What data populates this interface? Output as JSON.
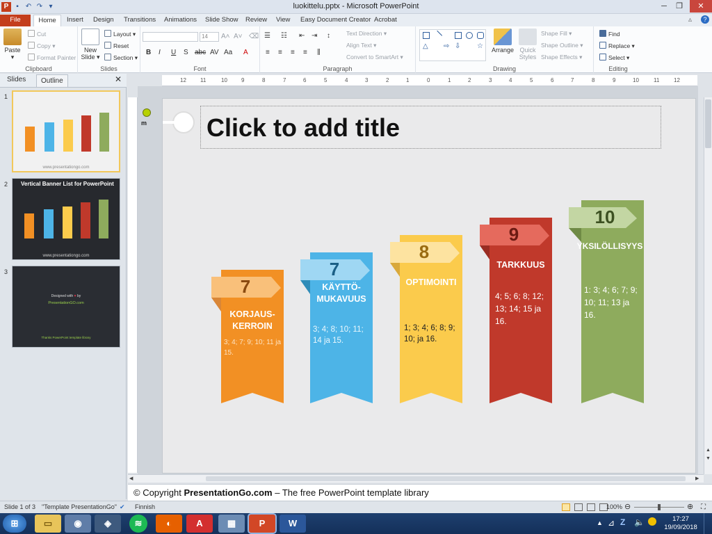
{
  "window": {
    "title": "luokittelu.pptx - Microsoft PowerPoint"
  },
  "tabs": [
    "File",
    "Home",
    "Insert",
    "Design",
    "Transitions",
    "Animations",
    "Slide Show",
    "Review",
    "View",
    "Easy Document Creator",
    "Acrobat"
  ],
  "ribbon": {
    "clipboard": {
      "paste": "Paste",
      "cut": "Cut",
      "copy": "Copy",
      "format_painter": "Format Painter",
      "label": "Clipboard"
    },
    "slides": {
      "new_slide": "New Slide",
      "layout": "Layout",
      "reset": "Reset",
      "section": "Section",
      "label": "Slides"
    },
    "font": {
      "size": "14",
      "label": "Font"
    },
    "paragraph": {
      "text_direction": "Text Direction",
      "align_text": "Align Text",
      "convert_smartart": "Convert to SmartArt",
      "label": "Paragraph"
    },
    "drawing": {
      "arrange": "Arrange",
      "quick_styles": "Quick Styles",
      "shape_fill": "Shape Fill",
      "shape_outline": "Shape Outline",
      "shape_effects": "Shape Effects",
      "label": "Drawing"
    },
    "editing": {
      "find": "Find",
      "replace": "Replace",
      "select": "Select",
      "label": "Editing"
    }
  },
  "panel": {
    "tab_slides": "Slides",
    "tab_outline": "Outline"
  },
  "thumbnails": [
    {
      "num": "1",
      "footer": "www.presentationgo.com"
    },
    {
      "num": "2",
      "title": "Vertical Banner List for PowerPoint",
      "footer": "www.presentationgo.com"
    },
    {
      "num": "3",
      "line1": "Designed with",
      "line2": "by",
      "site": "PresentationGO.com",
      "credit": "Thanks PowerPoint template library"
    }
  ],
  "ruler": [
    "12",
    "11",
    "10",
    "9",
    "8",
    "7",
    "6",
    "5",
    "4",
    "3",
    "2",
    "1",
    "0",
    "1",
    "2",
    "3",
    "4",
    "5",
    "6",
    "7",
    "8",
    "9",
    "10",
    "11",
    "12"
  ],
  "slide": {
    "title_placeholder": "Click to add title",
    "banners": [
      {
        "number": "7",
        "caption": "KORJAUS-\nKERROIN",
        "body": "3; 4; 7; 9; 10; 11 ja 15.",
        "color": "#f29024",
        "tab": "#f9c07a",
        "fold": "#d98637"
      },
      {
        "number": "7",
        "caption": "KÄYTTÖ-\nMUKAVUUS",
        "body": "3; 4; 8; 10; 11; 14 ja 15.",
        "color": "#4db4e7",
        "tab": "#9fd7f3",
        "fold": "#2f8cb8"
      },
      {
        "number": "8",
        "caption": "OPTIMOINTI",
        "body": "1; 3; 4; 6; 8; 9; 10; ja 16.",
        "color": "#fbcb4c",
        "tab": "#fde3a0",
        "fold": "#d9a83a"
      },
      {
        "number": "9",
        "caption": "TARKKUUS",
        "body": "4;  5;  6;  8; 12;  13;  14; 15 ja 16.",
        "color": "#c0392b",
        "tab": "#e56a5d",
        "fold": "#9a2c22"
      },
      {
        "number": "10",
        "caption": "YKSILÖLLISYYS",
        "body": "1: 3; 4; 6; 7; 9; 10;  11; 13 ja 16.",
        "color": "#8eab5d",
        "tab": "#c3d6a3",
        "fold": "#6f8a45"
      }
    ]
  },
  "notes": {
    "prefix": "© Copyright ",
    "brand": "PresentationGo.com",
    "suffix": " – The free PowerPoint template library"
  },
  "status": {
    "slide": "Slide 1 of 3",
    "theme": "\"Template PresentationGo\"",
    "finnish": "Finnish",
    "zoom": "100%"
  },
  "taskbar": {
    "time": "17:27",
    "date": "19/09/2018"
  }
}
